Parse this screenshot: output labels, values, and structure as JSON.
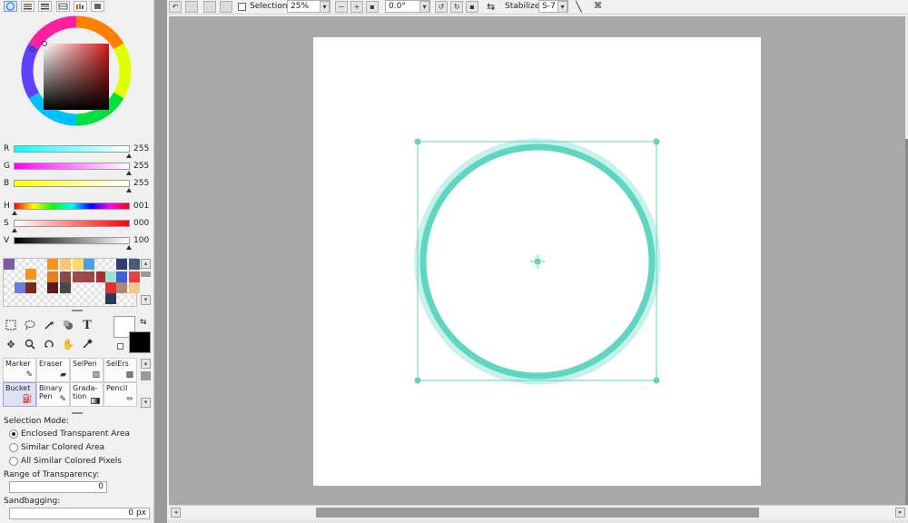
{
  "colors": {
    "accent": "#5fd6c2",
    "panel": "#f0f0f0",
    "canvas_bg": "#a9a9a9",
    "paper": "#ffffff"
  },
  "tabs": [
    "color-wheel-icon",
    "rgb-sliders-icon",
    "hsv-sliders-icon",
    "swatch-list-icon",
    "swatch-grid-icon",
    "scratchpad-icon"
  ],
  "rgb": {
    "r_label": "R",
    "r_value": "255",
    "g_label": "G",
    "g_value": "255",
    "b_label": "B",
    "b_value": "255"
  },
  "hsv": {
    "h_label": "H",
    "h_value": "001",
    "s_label": "S",
    "s_value": "000",
    "v_label": "V",
    "v_value": "100"
  },
  "swatches": [
    "#7b5aa6",
    "#f7931e",
    "#f7931e",
    "#f7c673",
    "#ffd966",
    "#4a9fdc",
    "#2c3e73",
    "#4a5a7a",
    "#e57f24",
    "#8b4a4a",
    "#9e4a4a",
    "#a04545",
    "#a53030",
    "#9fe0d0",
    "#3a5fd6",
    "#e84040",
    "#6c7de0",
    "#7a2a1a",
    "#5a1a1a",
    "#4a4a4a",
    "#e03030",
    "#b08a70",
    "#f0c890",
    "#2a3a5a"
  ],
  "tools": {
    "row1": [
      "rect-select-icon",
      "lasso-icon",
      "magic-wand-icon",
      "shape-icon",
      "text-icon"
    ],
    "row2": [
      "move-icon",
      "zoom-icon",
      "rotate-icon",
      "hand-icon",
      "eyedropper-icon"
    ]
  },
  "brushes": [
    {
      "label": "Marker"
    },
    {
      "label": "Eraser"
    },
    {
      "label": "SelPen"
    },
    {
      "label": "SelErs"
    },
    {
      "label": "Bucket"
    },
    {
      "label": "Binary Pen"
    },
    {
      "label": "Grada-tion"
    },
    {
      "label": "Pencil"
    }
  ],
  "selection_mode": {
    "label": "Selection Mode:",
    "options": [
      "Enclosed Transparent Area",
      "Similar Colored Area",
      "All Similar Colored Pixels"
    ],
    "selected": "Enclosed Transparent Area"
  },
  "range_of_transparency": {
    "label": "Range of Transparency:",
    "value": "0"
  },
  "sandbagging": {
    "label": "Sandbagging:",
    "value": "0 px"
  },
  "toolbar": {
    "selection_label": "Selection",
    "zoom_value": "25%",
    "rotation_value": "0.0°",
    "stabilizer_label": "Stabilizer",
    "stabilizer_value": "S-7"
  },
  "canvas": {
    "shape": "circle",
    "stroke_color": "#5fd6c2",
    "transform_box": true
  }
}
